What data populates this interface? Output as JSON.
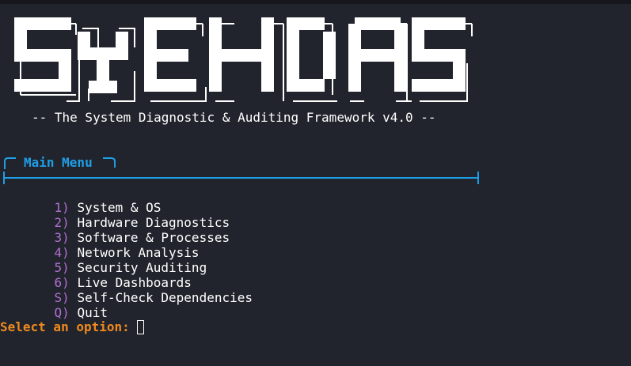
{
  "banner": {
    "logo_text": "SYEHDAS"
  },
  "subtitle": "-- The System Diagnostic & Auditing Framework v4.0 --",
  "menu": {
    "title": "Main Menu",
    "items": [
      {
        "key": "1)",
        "label": "System & OS"
      },
      {
        "key": "2)",
        "label": "Hardware Diagnostics"
      },
      {
        "key": "3)",
        "label": "Software & Processes"
      },
      {
        "key": "4)",
        "label": "Network Analysis"
      },
      {
        "key": "5)",
        "label": "Security Auditing"
      },
      {
        "key": "6)",
        "label": "Live Dashboards"
      },
      {
        "key": "S)",
        "label": "Self-Check Dependencies"
      },
      {
        "key": "Q)",
        "label": "Quit"
      }
    ]
  },
  "prompt": {
    "label": "Select an option:"
  },
  "colors": {
    "background": "#21242c",
    "accent_blue": "#1f9ee6",
    "menu_key": "#b06fd1",
    "prompt": "#f08a1f",
    "text": "#ffffff"
  }
}
